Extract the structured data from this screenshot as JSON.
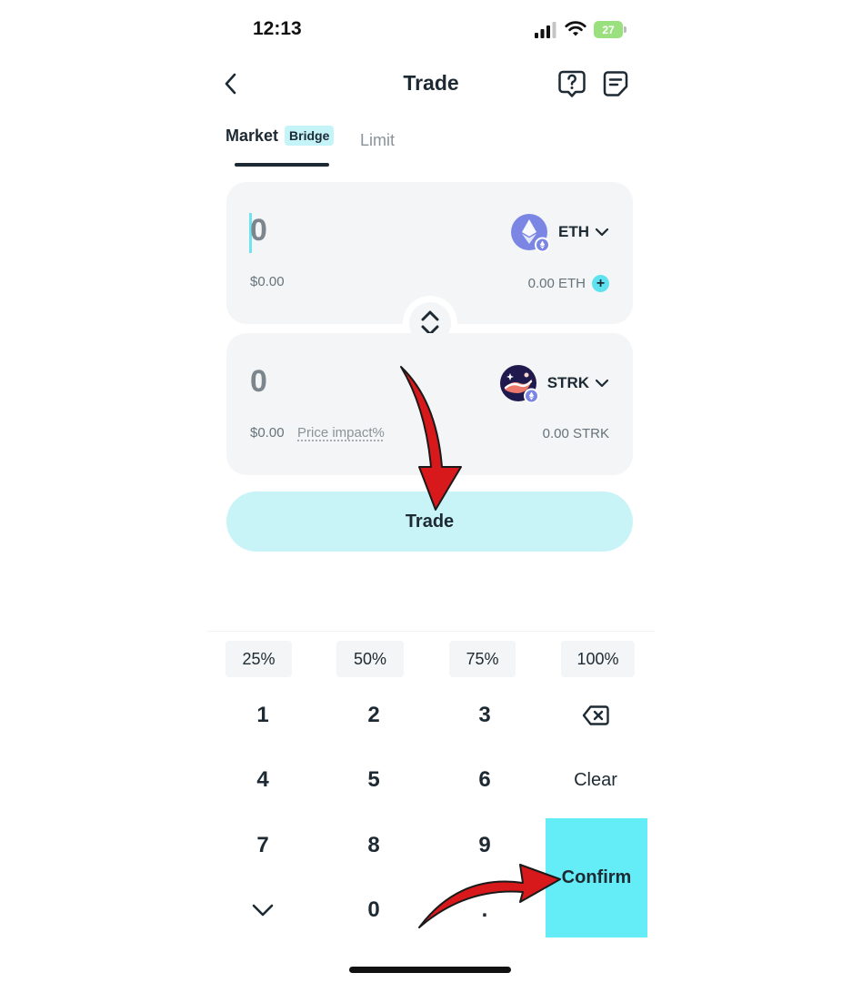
{
  "status_bar": {
    "time": "12:13",
    "battery_level": "27"
  },
  "header": {
    "title": "Trade",
    "back_icon": "chevron-left-icon",
    "help_icon": "question-bubble-icon",
    "orders_icon": "document-list-icon"
  },
  "tabs": {
    "market": {
      "label": "Market",
      "badge": "Bridge",
      "active": true
    },
    "limit": {
      "label": "Limit",
      "active": false
    }
  },
  "from_card": {
    "amount": "0",
    "usd_value": "$0.00",
    "token": "ETH",
    "token_icon": "ethereum-icon",
    "balance": "0.00 ETH",
    "add_icon": "plus-icon"
  },
  "swap_icon": "swap-vertical-icon",
  "to_card": {
    "amount": "0",
    "usd_value": "$0.00",
    "price_impact_label": "Price impact%",
    "token": "STRK",
    "token_icon": "starknet-icon",
    "balance": "0.00 STRK"
  },
  "trade_button": {
    "label": "Trade"
  },
  "keypad": {
    "percentages": [
      "25%",
      "50%",
      "75%",
      "100%"
    ],
    "digits": [
      "1",
      "2",
      "3",
      "4",
      "5",
      "6",
      "7",
      "8",
      "9",
      "0",
      "."
    ],
    "clear_label": "Clear",
    "confirm_label": "Confirm",
    "backspace_icon": "backspace-icon",
    "collapse_icon": "chevron-down-icon"
  },
  "colors": {
    "accent": "#64ecf7",
    "accent_light": "#c8f4f8",
    "text_primary": "#1d2a33",
    "card_bg": "#f3f5f6",
    "annotation_arrow": "#d7191c"
  }
}
